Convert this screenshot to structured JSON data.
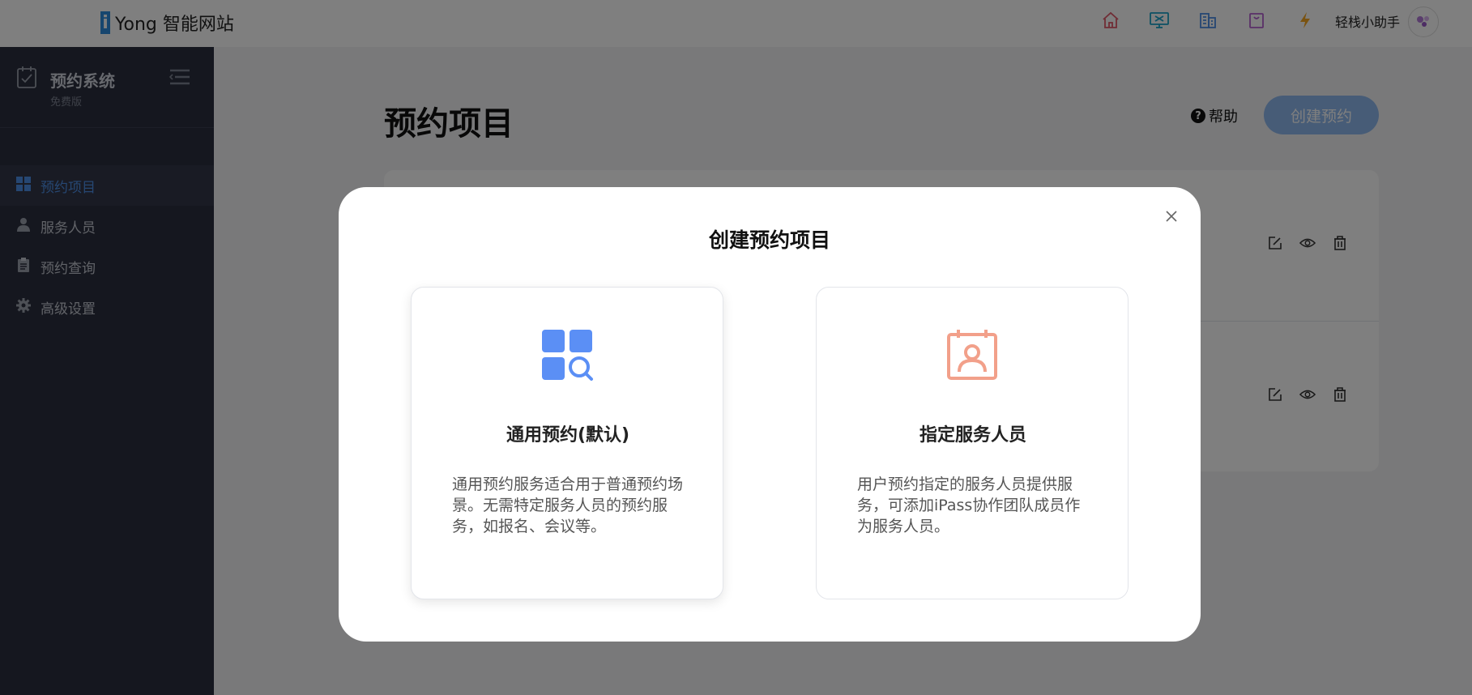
{
  "header": {
    "brand_logo": "i",
    "brand_text": "Yong 智能网站",
    "icons": [
      {
        "name": "home-icon",
        "color": "#e05a6a"
      },
      {
        "name": "screen-icon",
        "color": "#1aa3c9"
      },
      {
        "name": "building-icon",
        "color": "#4d8fe6"
      },
      {
        "name": "bag-icon",
        "color": "#b45fd1"
      },
      {
        "name": "lightning-icon",
        "color": "#f5a623"
      }
    ],
    "assistant": "轻栈小助手"
  },
  "sidebar": {
    "title": "预约系统",
    "subtitle": "免费版",
    "items": [
      {
        "label": "预约项目",
        "icon": "grid-icon",
        "active": true
      },
      {
        "label": "服务人员",
        "icon": "user-icon",
        "active": false
      },
      {
        "label": "预约查询",
        "icon": "clipboard-icon",
        "active": false
      },
      {
        "label": "高级设置",
        "icon": "gear-icon",
        "active": false
      }
    ]
  },
  "main": {
    "title": "预约项目",
    "help": "帮助",
    "create_button": "创建预约"
  },
  "modal": {
    "title": "创建预约项目",
    "options": [
      {
        "title": "通用预约(默认)",
        "desc": "通用预约服务适合用于普通预约场景。无需特定服务人员的预约服务，如报名、会议等。",
        "icon": "grid-search-icon",
        "color": "#5b8ff5"
      },
      {
        "title": "指定服务人员",
        "desc": "用户预约指定的服务人员提供服务，可添加iPass协作团队成员作为服务人员。",
        "icon": "calendar-person-icon",
        "color": "#f2a08a"
      }
    ]
  },
  "colors": {
    "accent": "#4d8fe6",
    "sidebar_bg": "#2b2f3e"
  }
}
